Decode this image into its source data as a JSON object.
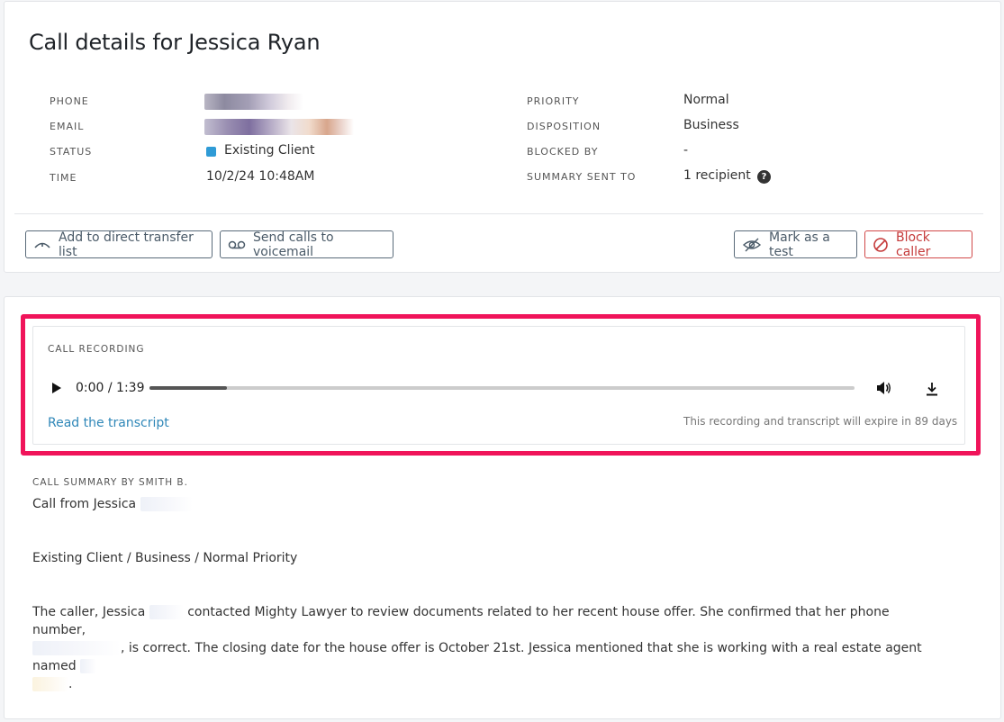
{
  "title": "Call details for Jessica Ryan",
  "details_left": [
    {
      "label": "PHONE",
      "value": ""
    },
    {
      "label": "EMAIL",
      "value": ""
    },
    {
      "label": "STATUS",
      "value": "Existing Client"
    },
    {
      "label": "TIME",
      "value": "10/2/24 10:48AM"
    }
  ],
  "details_right": [
    {
      "label": "PRIORITY",
      "value": "Normal"
    },
    {
      "label": "DISPOSITION",
      "value": "Business"
    },
    {
      "label": "BLOCKED BY",
      "value": "-"
    },
    {
      "label": "SUMMARY SENT TO",
      "value": "1 recipient"
    }
  ],
  "status_color": "#2f9bd6",
  "help_icon_glyph": "?",
  "actions": {
    "direct_transfer": "Add to direct transfer list",
    "voicemail": "Send calls to voicemail",
    "mark_test": "Mark as a test",
    "block": "Block caller"
  },
  "recording": {
    "heading": "CALL RECORDING",
    "time": "0:00 / 1:39",
    "progress_fraction": 0.11,
    "transcript_link": "Read the transcript",
    "expiry_note": "This recording and transcript will expire in 89 days"
  },
  "summary": {
    "heading": "CALL SUMMARY BY SMITH B.",
    "line1": "Call from Jessica",
    "line2": "Existing Client / Business / Normal Priority",
    "para_a": "The caller, Jessica",
    "para_b": "contacted Mighty Lawyer to review documents related to her recent house offer. She confirmed that her phone number,",
    "para_c": ", is correct. The closing date for the house offer is October 21st. Jessica mentioned that she is working with a real estate agent named",
    "para_d": "."
  },
  "highlight_color": "#f0145a"
}
